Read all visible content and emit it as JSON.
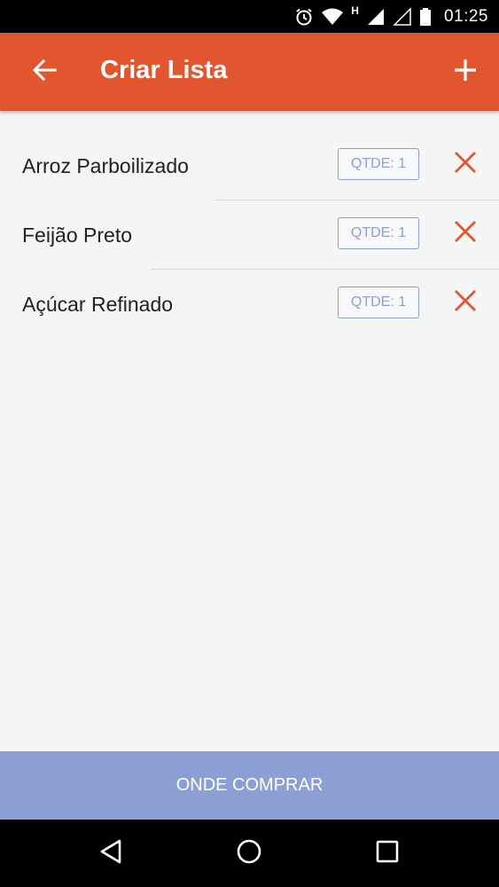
{
  "status_bar": {
    "time": "01:25",
    "network_label": "H",
    "icons": [
      "alarm-icon",
      "wifi-icon",
      "signal-icon",
      "signal-empty-icon",
      "battery-icon"
    ]
  },
  "app_bar": {
    "title": "Criar Lista",
    "back_icon": "arrow-back-icon",
    "add_icon": "plus-icon",
    "color": "#e1552f"
  },
  "items": [
    {
      "name": "Arroz Parboilizado",
      "qty_label": "QTDE: 1"
    },
    {
      "name": "Feijão Preto",
      "qty_label": "QTDE: 1"
    },
    {
      "name": "Açúcar Refinado",
      "qty_label": "QTDE: 1"
    }
  ],
  "remove_icon": "close-icon",
  "remove_color": "#e1552f",
  "qty_color": "#8c9fd0",
  "bottom_button": {
    "label": "ONDE COMPRAR",
    "color": "#8c9fd5"
  },
  "nav_bar": {
    "icons": [
      "back-triangle-icon",
      "home-circle-icon",
      "recents-square-icon"
    ]
  }
}
